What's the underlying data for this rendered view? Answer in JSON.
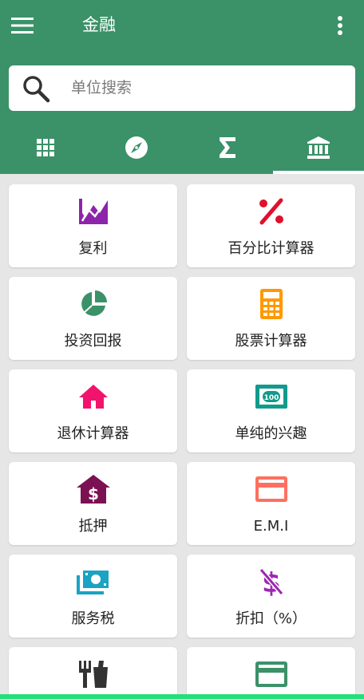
{
  "appbar": {
    "title": "金融"
  },
  "search": {
    "placeholder": "单位搜索"
  },
  "tabs": [
    {
      "icon": "grid-icon",
      "active": false
    },
    {
      "icon": "compass-icon",
      "active": false
    },
    {
      "icon": "sigma-icon",
      "active": false
    },
    {
      "icon": "bank-icon",
      "active": true
    }
  ],
  "cards": [
    {
      "label": "复利",
      "icon": "line-chart-icon",
      "color": "#8e24aa"
    },
    {
      "label": "百分比计算器",
      "icon": "percent-icon",
      "color": "#e0102a"
    },
    {
      "label": "投资回报",
      "icon": "pie-chart-icon",
      "color": "#3b9168"
    },
    {
      "label": "股票计算器",
      "icon": "calculator-icon",
      "color": "#ff9800"
    },
    {
      "label": "退休计算器",
      "icon": "home-icon",
      "color": "#f2136c"
    },
    {
      "label": "单纯的兴趣",
      "icon": "banknote-100-icon",
      "color": "#129a8c"
    },
    {
      "label": "抵押",
      "icon": "mortgage-house-icon",
      "color": "#7b1152"
    },
    {
      "label": "E.M.I",
      "icon": "credit-card-icon",
      "color": "#ff6f60"
    },
    {
      "label": "服务税",
      "icon": "cash-stack-icon",
      "color": "#1aa3c2"
    },
    {
      "label": "折扣（%）",
      "icon": "no-dollar-icon",
      "color": "#9c27b0"
    },
    {
      "label": "",
      "icon": "restaurant-icon",
      "color": "#333333"
    },
    {
      "label": "",
      "icon": "card-icon",
      "color": "#3b9168"
    }
  ]
}
